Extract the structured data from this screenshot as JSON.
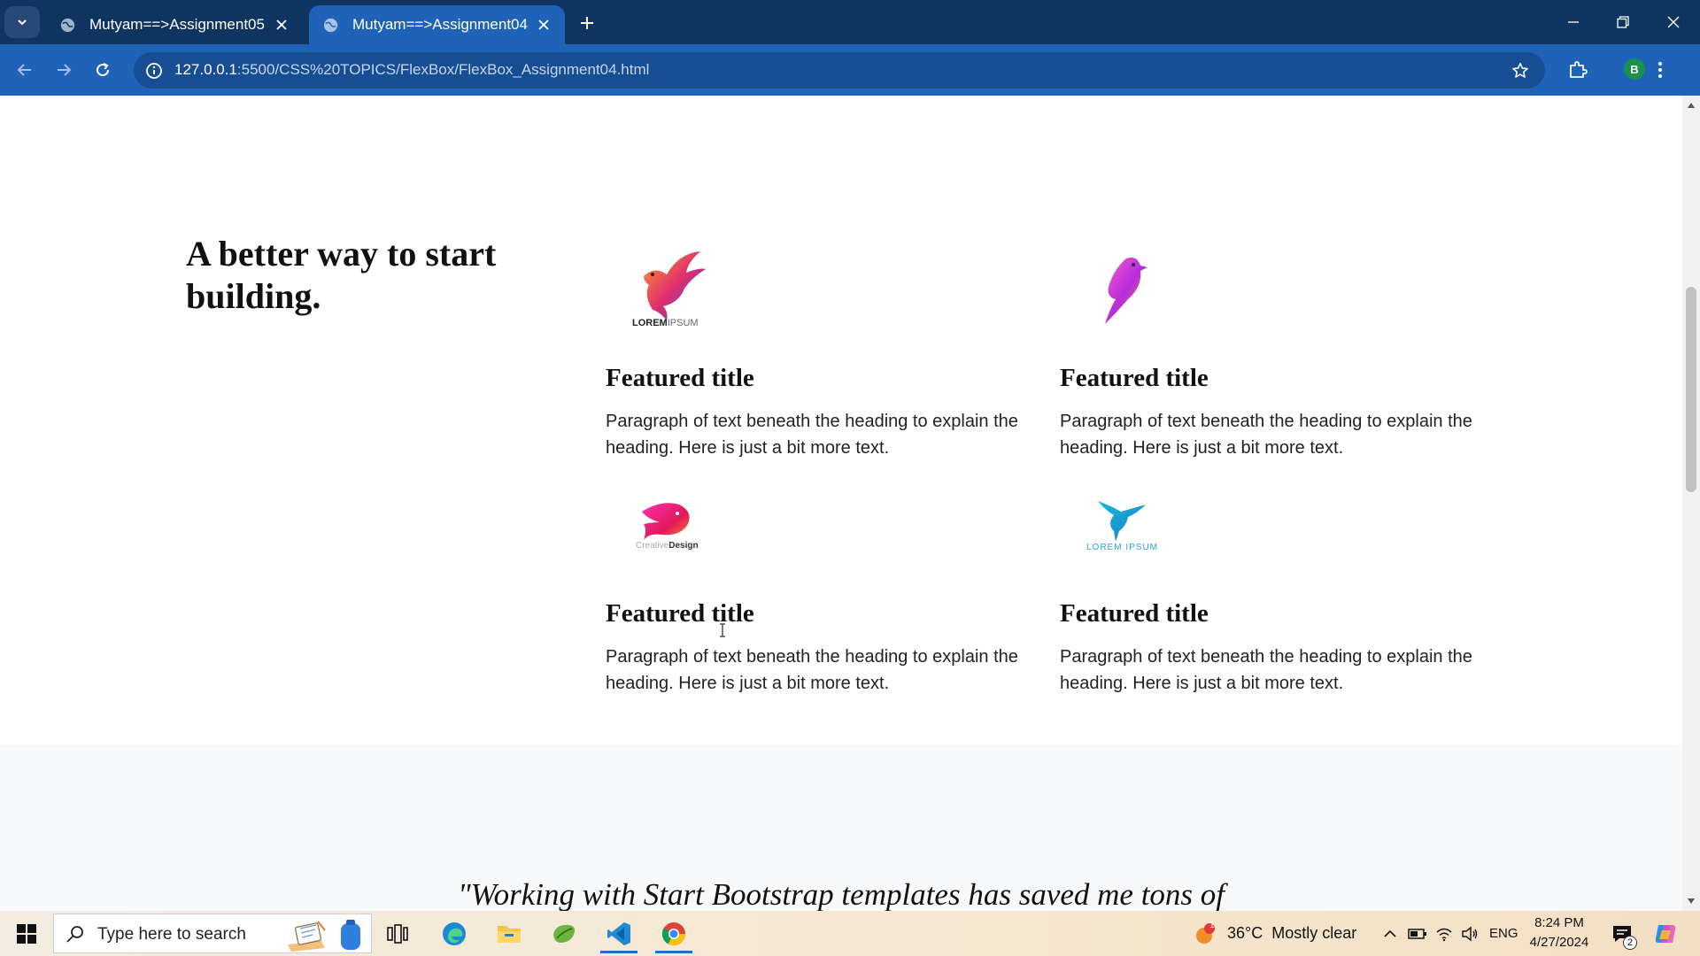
{
  "browser": {
    "tabs": [
      {
        "label": "Mutyam==>Assignment05",
        "active": false
      },
      {
        "label": "Mutyam==>Assignment04",
        "active": true
      }
    ],
    "url_host": "127.0.0.1",
    "url_rest": ":5500/CSS%20TOPICS/FlexBox/FlexBox_Assignment04.html",
    "profile_initial": "B"
  },
  "page": {
    "heading": "A better way to start building.",
    "features": [
      {
        "logo": "bird-logo-lorem-ipsum",
        "logo_text_a": "LOREM",
        "logo_text_b": "IPSUM",
        "title": "Featured title",
        "text": "Paragraph of text beneath the heading to explain the heading. Here is just a bit more text."
      },
      {
        "logo": "parrot-logo",
        "title": "Featured title",
        "text": "Paragraph of text beneath the heading to explain the heading. Here is just a bit more text."
      },
      {
        "logo": "fish-logo-creative-design",
        "logo_text_a": "Creative",
        "logo_text_b": "Design",
        "title": "Featured title",
        "text": "Paragraph of text beneath the heading to explain the heading. Here is just a bit more text."
      },
      {
        "logo": "hummingbird-logo-lorem-ipsum",
        "logo_text_a": "LOREM IPSUM",
        "title": "Featured title",
        "text": "Paragraph of text beneath the heading to explain the heading. Here is just a bit more text."
      }
    ],
    "quote": "\"Working with Start Bootstrap templates has saved me tons of"
  },
  "taskbar": {
    "search_placeholder": "Type here to search",
    "weather": "36°C  Mostly clear",
    "weather_badge": "1",
    "language": "ENG",
    "time": "8:24 PM",
    "date": "4/27/2024",
    "notification_count": "2"
  },
  "colors": {
    "tabbar": "#0f3460",
    "toolbar": "#1e63b8",
    "taskbar": "#f6e8d2"
  }
}
